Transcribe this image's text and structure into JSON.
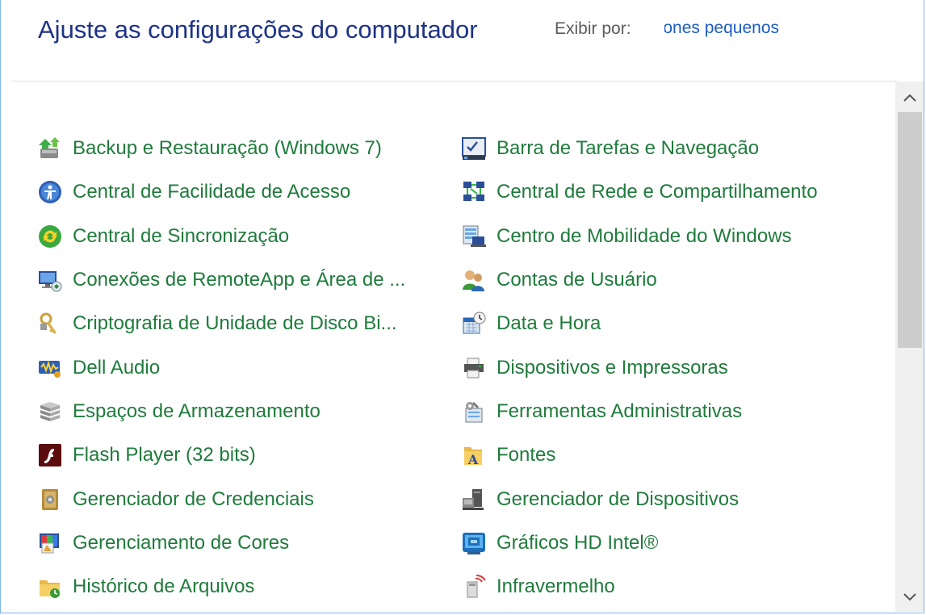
{
  "header": {
    "title": "Ajuste as configurações do computador",
    "view_by_label": "Exibir por:",
    "view_by_value": "Ícones pequenos"
  },
  "columns": {
    "left": [
      {
        "label": "Backup e Restauração (Windows 7)",
        "icon": "backup-icon"
      },
      {
        "label": "Central de Facilidade de Acesso",
        "icon": "ease-of-access-icon"
      },
      {
        "label": "Central de Sincronização",
        "icon": "sync-icon"
      },
      {
        "label": "Conexões de RemoteApp e Área de ...",
        "icon": "remote-desktop-icon"
      },
      {
        "label": "Criptografia de Unidade de Disco Bi...",
        "icon": "bitlocker-icon"
      },
      {
        "label": "Dell Audio",
        "icon": "audio-icon"
      },
      {
        "label": "Espaços de Armazenamento",
        "icon": "storage-spaces-icon"
      },
      {
        "label": "Flash Player (32 bits)",
        "icon": "flash-icon"
      },
      {
        "label": "Gerenciador de Credenciais",
        "icon": "credential-icon"
      },
      {
        "label": "Gerenciamento de Cores",
        "icon": "color-management-icon"
      },
      {
        "label": "Histórico de Arquivos",
        "icon": "file-history-icon"
      }
    ],
    "right": [
      {
        "label": "Barra de Tarefas e Navegação",
        "icon": "taskbar-icon"
      },
      {
        "label": "Central de Rede e Compartilhamento",
        "icon": "network-icon"
      },
      {
        "label": "Centro de Mobilidade do Windows",
        "icon": "mobility-icon"
      },
      {
        "label": "Contas de Usuário",
        "icon": "user-accounts-icon"
      },
      {
        "label": "Data e Hora",
        "icon": "date-time-icon"
      },
      {
        "label": "Dispositivos e Impressoras",
        "icon": "printer-icon"
      },
      {
        "label": "Ferramentas Administrativas",
        "icon": "admin-tools-icon"
      },
      {
        "label": "Fontes",
        "icon": "fonts-icon"
      },
      {
        "label": "Gerenciador de Dispositivos",
        "icon": "device-manager-icon"
      },
      {
        "label": "Gráficos HD Intel®",
        "icon": "intel-graphics-icon"
      },
      {
        "label": "Infravermelho",
        "icon": "infrared-icon"
      }
    ]
  },
  "colors": {
    "title": "#1e3287",
    "link": "#1f7b3c",
    "view_value": "#1c5cc4",
    "border": "#7eb4ea"
  }
}
